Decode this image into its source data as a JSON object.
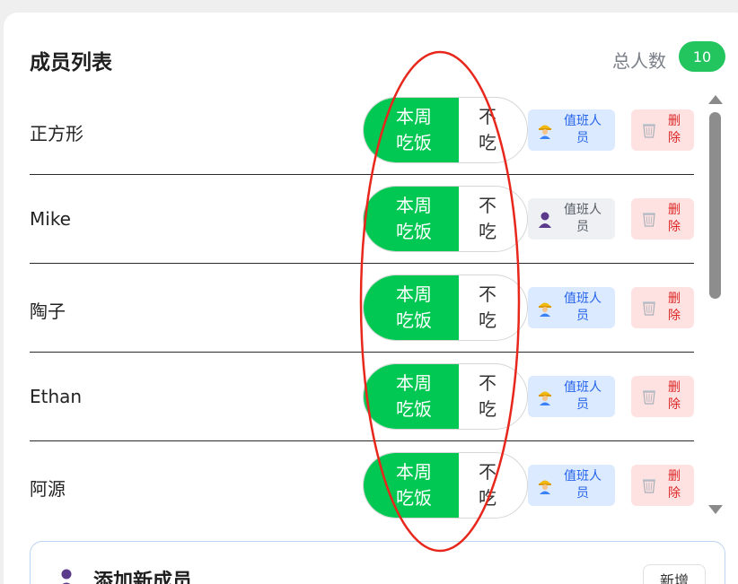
{
  "header": {
    "title": "成员列表",
    "total_label": "总人数",
    "total_count": "10"
  },
  "toggle": {
    "on_label": "本周\n吃饭",
    "off_label": "不\n吃"
  },
  "members": [
    {
      "name": "正方形",
      "duty_label": "值班人\n员",
      "duty_state": "active",
      "delete_label": "删\n除"
    },
    {
      "name": "Mike",
      "duty_label": "值班人\n员",
      "duty_state": "inactive",
      "delete_label": "删\n除"
    },
    {
      "name": "陶子",
      "duty_label": "值班人\n员",
      "duty_state": "active",
      "delete_label": "删\n除"
    },
    {
      "name": "Ethan",
      "duty_label": "值班人\n员",
      "duty_state": "active",
      "delete_label": "删\n除"
    },
    {
      "name": "阿源",
      "duty_label": "值班人\n员",
      "duty_state": "active",
      "delete_label": "删\n除"
    }
  ],
  "add_member": {
    "title": "添加新成员",
    "button_label": "新增"
  },
  "icons": {
    "duty_active": "construction-worker-icon",
    "duty_inactive": "person-silhouette-icon",
    "delete": "wastebasket-icon",
    "add_member": "person-silhouette-icon"
  },
  "colors": {
    "accent_green": "#00c853",
    "badge_green": "#22c55e",
    "duty_blue": "#2563eb",
    "delete_red": "#dc2626",
    "annotation_red": "#e8271c"
  }
}
